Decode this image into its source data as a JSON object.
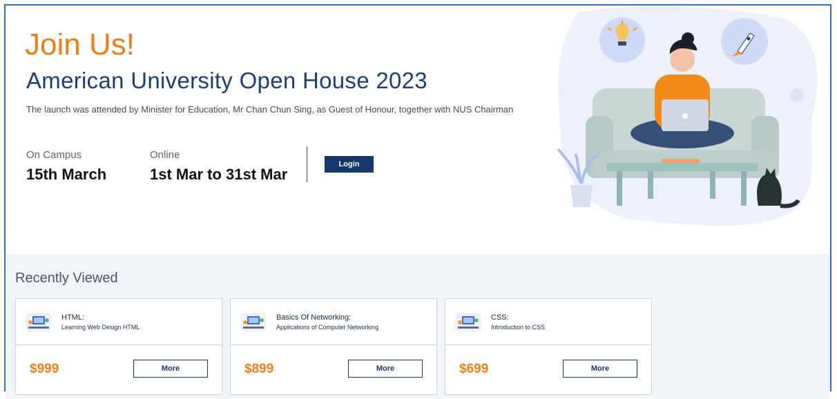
{
  "hero": {
    "join": "Join Us!",
    "title": "American University Open House 2023",
    "description": "The launch was attended by Minister for Education, Mr Chan Chun Sing, as Guest of Honour, together with NUS Chairman",
    "on_campus": {
      "label": "On Campus",
      "value": "15th March"
    },
    "online": {
      "label": "Online",
      "value": "1st Mar to 31st Mar"
    },
    "login_label": "Login"
  },
  "recent": {
    "title": "Recently Viewed",
    "more_label": "More",
    "cards": [
      {
        "title": "HTML:",
        "subtitle": "Learning Web Design HTML",
        "price": "$999"
      },
      {
        "title": "Basics Of Networking:",
        "subtitle": "Applications of Computer Networking",
        "price": "$899"
      },
      {
        "title": "CSS:",
        "subtitle": "Introduction to CSS",
        "price": "$699"
      }
    ]
  },
  "colors": {
    "accent": "#ef7d1a",
    "navy": "#13386a",
    "frame": "#2f6fb7"
  }
}
